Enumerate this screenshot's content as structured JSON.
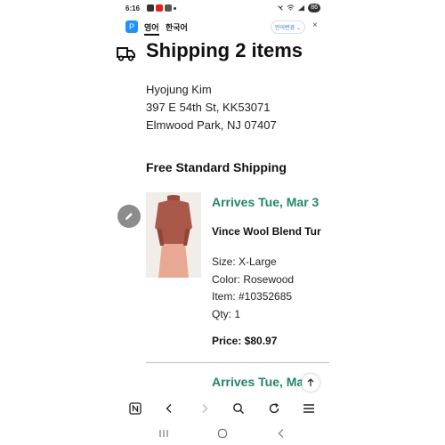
{
  "status_bar": {
    "time": "6:16",
    "battery": "86"
  },
  "translate_bar": {
    "source_lang": "영어",
    "target_lang": "한국어",
    "change_label": "언어변경 ⌄",
    "close": "×"
  },
  "shipment": {
    "title": "Shipping 2 items",
    "address": [
      "Hyojung Kim",
      "397 E 54th St, KK53071",
      "Elmwood Park, NJ 07407"
    ],
    "method": "Free Standard Shipping"
  },
  "item": {
    "arrives": "Arrives Tue, Mar 3",
    "name": "Vince Wool Blend Tur",
    "size": "Size: X-Large",
    "color": "Color: Rosewood",
    "item_no": "Item: #10352685",
    "qty": "Qty: 1",
    "price": "Price: $80.97"
  },
  "item2": {
    "arrives": "Arrives Tue, Mar 3"
  },
  "colors": {
    "accent_green": "#23856b",
    "papago_blue": "#1e90ff"
  },
  "icons": [
    "truck-icon",
    "edit-icon",
    "scroll-top-icon",
    "n-tab-icon",
    "back-icon",
    "forward-icon",
    "search-icon",
    "reload-icon",
    "menu-icon"
  ]
}
